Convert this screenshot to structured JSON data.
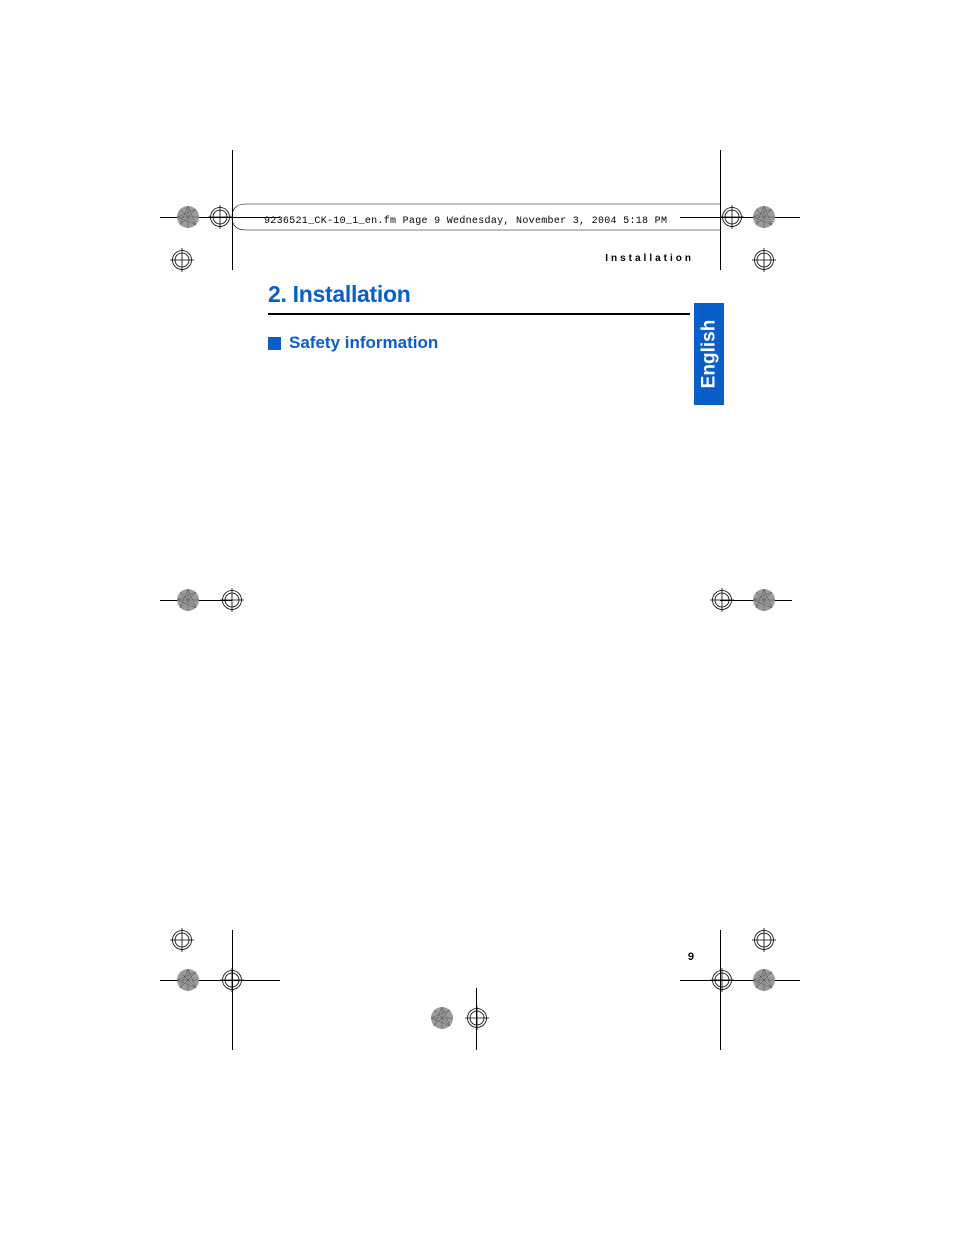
{
  "header_line": "9236521_CK-10_1_en.fm  Page 9  Wednesday, November 3, 2004  5:18 PM",
  "running_head": "Installation",
  "chapter": "2. Installation",
  "section": "Safety information",
  "language_tab": "English",
  "page_number": "9"
}
